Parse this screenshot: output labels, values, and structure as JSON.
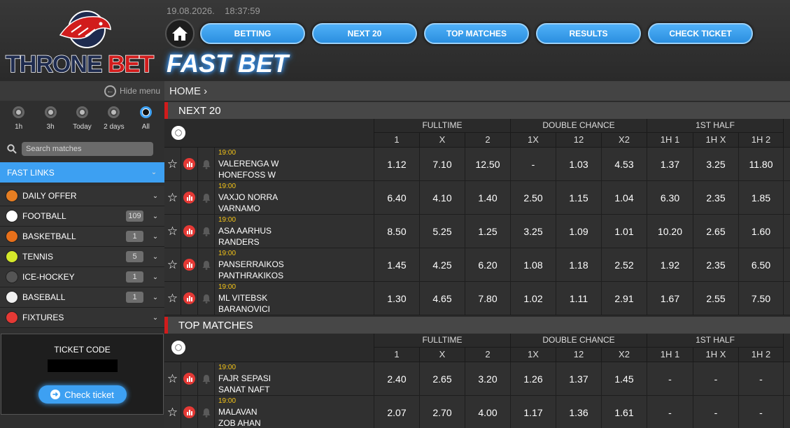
{
  "brand": {
    "name_white": "THRONE ",
    "name_red": "BET",
    "title": "FAST BET"
  },
  "datetime": {
    "date": "19.08.2026.",
    "time": "18:37:59"
  },
  "nav": [
    "BETTING",
    "NEXT 20",
    "TOP MATCHES",
    "RESULTS",
    "CHECK TICKET"
  ],
  "sidebar": {
    "hide_menu": "Hide menu",
    "time_filters": [
      {
        "label": "1h",
        "selected": false
      },
      {
        "label": "3h",
        "selected": false
      },
      {
        "label": "Today",
        "selected": false
      },
      {
        "label": "2 days",
        "selected": false
      },
      {
        "label": "All",
        "selected": true
      }
    ],
    "search_placeholder": "Search matches",
    "fast_links": "FAST LINKS",
    "sports": [
      {
        "label": "DAILY OFFER",
        "count": "",
        "icon": "daily-offer-icon",
        "color": "#e67e22"
      },
      {
        "label": "FOOTBALL",
        "count": "109",
        "icon": "football-icon",
        "color": "#ffffff"
      },
      {
        "label": "BASKETBALL",
        "count": "1",
        "icon": "basketball-icon",
        "color": "#e8701a"
      },
      {
        "label": "TENNIS",
        "count": "5",
        "icon": "tennis-icon",
        "color": "#d4e82a"
      },
      {
        "label": "ICE-HOCKEY",
        "count": "1",
        "icon": "ice-hockey-icon",
        "color": "#555555"
      },
      {
        "label": "BASEBALL",
        "count": "1",
        "icon": "baseball-icon",
        "color": "#f2f2f2"
      },
      {
        "label": "FIXTURES",
        "count": "",
        "icon": "fixtures-icon",
        "color": "#e53935"
      }
    ],
    "ticket": {
      "title": "TICKET CODE",
      "button": "Check ticket"
    }
  },
  "breadcrumb": "HOME",
  "groups": [
    "FULLTIME",
    "DOUBLE CHANCE",
    "1ST HALF"
  ],
  "columns": [
    "1",
    "X",
    "2",
    "1X",
    "12",
    "X2",
    "1H 1",
    "1H X",
    "1H 2"
  ],
  "sections": [
    {
      "title": "NEXT 20",
      "matches": [
        {
          "time": "19:00",
          "home": "VALERENGA W",
          "away": "HONEFOSS W",
          "odds": [
            "1.12",
            "7.10",
            "12.50",
            "-",
            "1.03",
            "4.53",
            "1.37",
            "3.25",
            "11.80"
          ]
        },
        {
          "time": "19:00",
          "home": "VAXJO NORRA",
          "away": "VARNAMO",
          "odds": [
            "6.40",
            "4.10",
            "1.40",
            "2.50",
            "1.15",
            "1.04",
            "6.30",
            "2.35",
            "1.85"
          ]
        },
        {
          "time": "19:00",
          "home": "ASA AARHUS",
          "away": "RANDERS",
          "odds": [
            "8.50",
            "5.25",
            "1.25",
            "3.25",
            "1.09",
            "1.01",
            "10.20",
            "2.65",
            "1.60"
          ]
        },
        {
          "time": "19:00",
          "home": "PANSERRAIKOS",
          "away": "PANTHRAKIKOS",
          "odds": [
            "1.45",
            "4.25",
            "6.20",
            "1.08",
            "1.18",
            "2.52",
            "1.92",
            "2.35",
            "6.50"
          ]
        },
        {
          "time": "19:00",
          "home": "ML VITEBSK",
          "away": "BARANOVICI",
          "odds": [
            "1.30",
            "4.65",
            "7.80",
            "1.02",
            "1.11",
            "2.91",
            "1.67",
            "2.55",
            "7.50"
          ]
        }
      ]
    },
    {
      "title": "TOP MATCHES",
      "matches": [
        {
          "time": "19:00",
          "home": "FAJR SEPASI",
          "away": "SANAT NAFT",
          "odds": [
            "2.40",
            "2.65",
            "3.20",
            "1.26",
            "1.37",
            "1.45",
            "-",
            "-",
            "-"
          ]
        },
        {
          "time": "19:00",
          "home": "MALAVAN",
          "away": "ZOB AHAN",
          "odds": [
            "2.07",
            "2.70",
            "4.00",
            "1.17",
            "1.36",
            "1.61",
            "-",
            "-",
            "-"
          ]
        }
      ]
    }
  ],
  "colors": {
    "accent": "#3da0f2",
    "brand_red": "#d11c1c",
    "time": "#f5c518"
  }
}
